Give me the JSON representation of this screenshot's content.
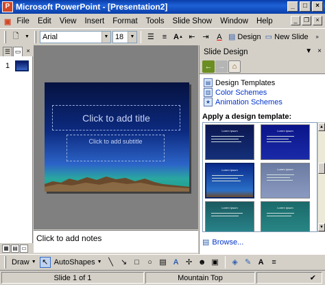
{
  "window": {
    "title": "Microsoft PowerPoint - [Presentation2]"
  },
  "menu": {
    "items": [
      "File",
      "Edit",
      "View",
      "Insert",
      "Format",
      "Tools",
      "Slide Show",
      "Window",
      "Help"
    ]
  },
  "toolbar": {
    "font": "Arial",
    "size": "18",
    "design_label": "Design",
    "new_slide_label": "New Slide"
  },
  "slides_panel": {
    "slide_number": "1"
  },
  "slide": {
    "title_placeholder": "Click to add title",
    "subtitle_placeholder": "Click to add subtitle"
  },
  "notes": {
    "placeholder": "Click to add notes"
  },
  "task_pane": {
    "title": "Slide Design",
    "links": [
      "Design Templates",
      "Color Schemes",
      "Animation Schemes"
    ],
    "apply_heading": "Apply a design template:",
    "template_caption": "Lorem Ipsum",
    "browse_label": "Browse..."
  },
  "draw_toolbar": {
    "draw_label": "Draw",
    "autoshapes_label": "AutoShapes"
  },
  "status": {
    "slide": "Slide 1 of 1",
    "design": "Mountain Top"
  }
}
